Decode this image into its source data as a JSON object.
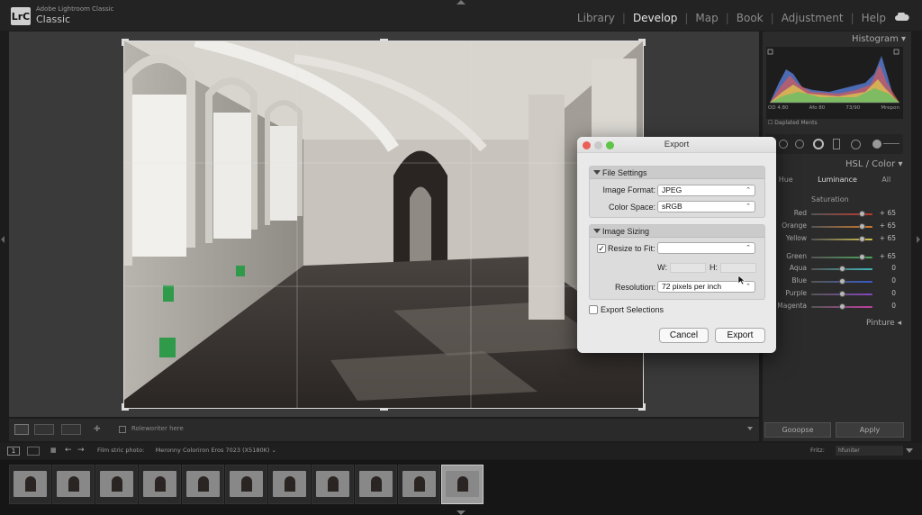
{
  "app": {
    "subtitle": "Adobe Lightroom Classic",
    "name": "Classic",
    "logo": "LrC"
  },
  "modules": [
    {
      "label": "Library",
      "active": false
    },
    {
      "label": "Develop",
      "active": true
    },
    {
      "label": "Map",
      "active": false
    },
    {
      "label": "Book",
      "active": false
    },
    {
      "label": "Adjustment",
      "active": false
    },
    {
      "label": "Help",
      "active": false
    }
  ],
  "right_panel": {
    "histogram_title": "Histogram",
    "histogram_values": [
      "OD 4.80",
      "Afo 80",
      "73/90",
      "Mrepon"
    ],
    "original_label": "Daplated Ments",
    "hsl_title": "HSL / Color",
    "hsl_tabs": [
      "Hue",
      "Luminance",
      "All"
    ],
    "saturation_label": "Saturation",
    "sliders": [
      {
        "name": "Red",
        "value": "+ 65",
        "level": 0.82,
        "color": "#c0392b"
      },
      {
        "name": "Orange",
        "value": "+ 65",
        "level": 0.82,
        "color": "#d07a2a"
      },
      {
        "name": "Yellow",
        "value": "+ 65",
        "level": 0.82,
        "color": "#cfc14a"
      },
      {
        "name": "Green",
        "value": "+ 65",
        "level": 0.82,
        "color": "#4aa85a"
      },
      {
        "name": "Aqua",
        "value": "0",
        "level": 0.5,
        "color": "#3fb4b8"
      },
      {
        "name": "Blue",
        "value": "0",
        "level": 0.5,
        "color": "#3a5bc8"
      },
      {
        "name": "Purple",
        "value": "0",
        "level": 0.5,
        "color": "#8646c0"
      },
      {
        "name": "Magenta",
        "value": "0",
        "level": 0.5,
        "color": "#c040a0"
      }
    ],
    "finish_title": "Pinture",
    "prev_button": "Gooopse",
    "apply_button": "Apply"
  },
  "toolbar": {
    "label": "Roleworiter here"
  },
  "filmstrip": {
    "source": "Film stric photo:",
    "source_name": "Meronny Coloriron Eros 7023 (X5180K)",
    "filter_label": "Fritz:",
    "filter_value": "hfuniter",
    "thumb_count": 11,
    "selected_index": 10
  },
  "dialog": {
    "title": "Export",
    "file_settings": {
      "header": "File Settings",
      "image_format_label": "Image Format:",
      "image_format_value": "JPEG",
      "color_space_label": "Color Space:",
      "color_space_value": "sRGB"
    },
    "image_sizing": {
      "header": "Image Sizing",
      "resize_label": "Resize to Fit:",
      "resize_checked": true,
      "resize_value": "",
      "w_label": "W:",
      "h_label": "H:",
      "resolution_label": "Resolution:",
      "resolution_value": "72 pixels per inch"
    },
    "export_selections_label": "Export Selections",
    "export_selections_checked": false,
    "cancel_label": "Cancel",
    "export_label": "Export"
  },
  "colors": {
    "accent_active": "#e6e6e6",
    "panel": "#2b2b2b",
    "dialog_bg": "#e9e9e9"
  }
}
